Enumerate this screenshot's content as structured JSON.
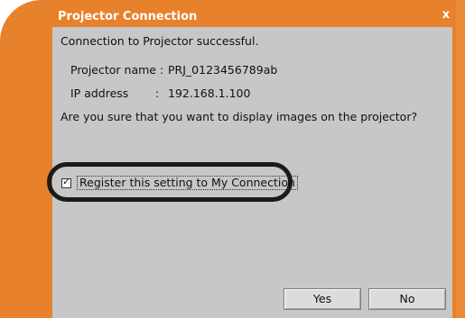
{
  "dialog": {
    "title": "Projector Connection",
    "close_glyph": "x",
    "message": "Connection to Projector successful.",
    "projector_name_label": "Projector name :",
    "projector_name_value": "PRJ_0123456789ab",
    "ip_label": "IP address",
    "ip_colon": ":",
    "ip_value": "192.168.1.100",
    "question": "Are you sure that you want to display images on the projector?",
    "checkbox": {
      "label": "Register this setting to My Connection",
      "checked": true
    },
    "buttons": {
      "yes": "Yes",
      "no": "No"
    }
  },
  "colors": {
    "frame": "#e8812b",
    "panel": "#c6c7c9"
  }
}
